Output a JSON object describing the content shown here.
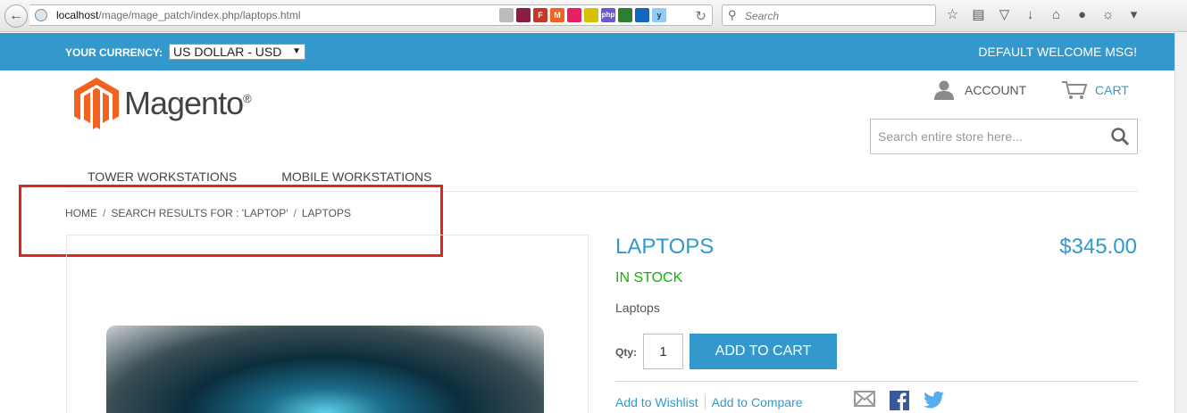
{
  "browser": {
    "url_host": "localhost",
    "url_path": "/mage/mage_patch/index.php/laptops.html",
    "search_placeholder": "Search"
  },
  "header": {
    "currency_label": "YOUR CURRENCY:",
    "currency_value": "US DOLLAR - USD",
    "welcome": "DEFAULT WELCOME MSG!",
    "logo_text": "Magento",
    "logo_mark": "®",
    "account_label": "ACCOUNT",
    "cart_label": "CART",
    "search_placeholder": "Search entire store here..."
  },
  "nav": {
    "items": [
      "TOWER WORKSTATIONS",
      "MOBILE WORKSTATIONS"
    ]
  },
  "breadcrumb": {
    "items": [
      "HOME",
      "SEARCH RESULTS FOR : 'LAPTOP'",
      "LAPTOPS"
    ],
    "separator": "/"
  },
  "product": {
    "name": "LAPTOPS",
    "price": "$345.00",
    "stock": "IN STOCK",
    "short_description": "Laptops",
    "qty_label": "Qty:",
    "qty_value": "1",
    "add_to_cart": "ADD TO CART",
    "wishlist_label": "Add to Wishlist",
    "compare_label": "Add to Compare"
  },
  "colors": {
    "brand": "#3399cc",
    "stock": "#11b400",
    "highlight": "#e2241e",
    "logo_orange": "#f26322"
  },
  "icons": [
    "back-icon",
    "globe-icon",
    "reload-icon",
    "search-icon",
    "star-icon",
    "reader-icon",
    "pocket-icon",
    "download-icon",
    "home-icon",
    "chat-icon",
    "menu-icon",
    "person-icon",
    "cart-icon",
    "mail-icon",
    "facebook-icon",
    "twitter-icon"
  ]
}
